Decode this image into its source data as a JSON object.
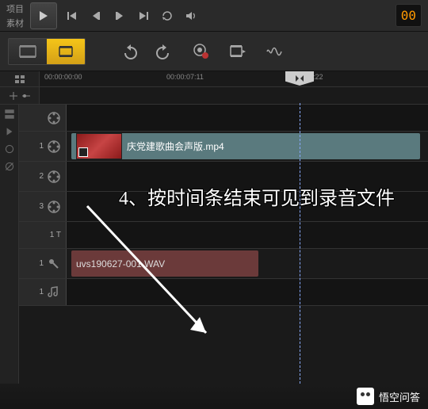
{
  "topbar": {
    "label_project": "项目",
    "label_material": "素材",
    "timecode": "00"
  },
  "ruler": {
    "t0": "00:00:00:00",
    "t1": "00:00:07:11",
    "t2": "00:00:14:22"
  },
  "tracks": {
    "video1": {
      "label": "1",
      "clip_name": "庆党建歌曲会声版.mp4"
    },
    "overlay2": {
      "label": "2"
    },
    "overlay3": {
      "label": "3"
    },
    "title1": {
      "label": "1 T"
    },
    "voice1": {
      "label": "1",
      "clip_name": "uvs190627-001.WAV"
    },
    "music1": {
      "label": "1"
    }
  },
  "annotation": {
    "text": "4、按时间条结束可见到录音文件"
  },
  "footer": {
    "brand": "悟空问答"
  }
}
